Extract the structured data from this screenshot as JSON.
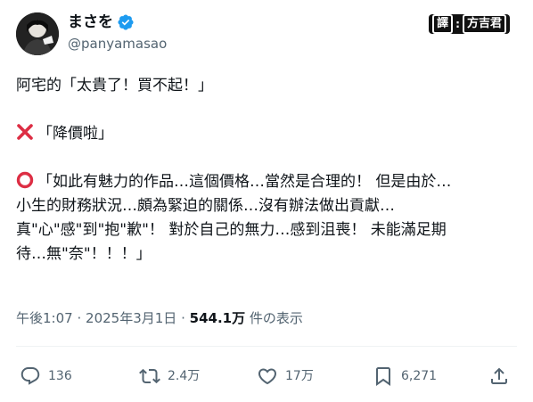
{
  "author": {
    "display_name": "まさを",
    "handle": "@panyamasao",
    "verified_color": "#1d9bf0"
  },
  "translator_badge": {
    "left": "譯",
    "separator": ":",
    "right": "方吉君"
  },
  "tweet": {
    "lines": [
      "阿宅的「太貴了！買不起！」",
      "",
      "「降價啦」",
      "",
      "「如此有魅力的作品…這個價格…當然是合理的！ 但是由於…",
      "小生的財務狀況…頗為緊迫的關係…沒有辦法做出貢獻…",
      "真\"心\"感\"到\"抱\"歉\"！ 對於自己的無力…感到沮喪！ 未能滿足期",
      "待…無\"奈\"！！！」"
    ],
    "cross_color": "#dd2e44",
    "circle_color": "#dd2e44"
  },
  "meta": {
    "time": "午後1:07",
    "dot": "·",
    "date": "2025年3月1日",
    "views_count": "544.1万",
    "views_label": "件の表示"
  },
  "actions": {
    "reply_count": "136",
    "retweet_count": "2.4万",
    "like_count": "17万",
    "bookmark_count": "6,271"
  },
  "colors": {
    "text": "#0f1419",
    "secondary": "#536471",
    "divider": "#eff3f4"
  }
}
